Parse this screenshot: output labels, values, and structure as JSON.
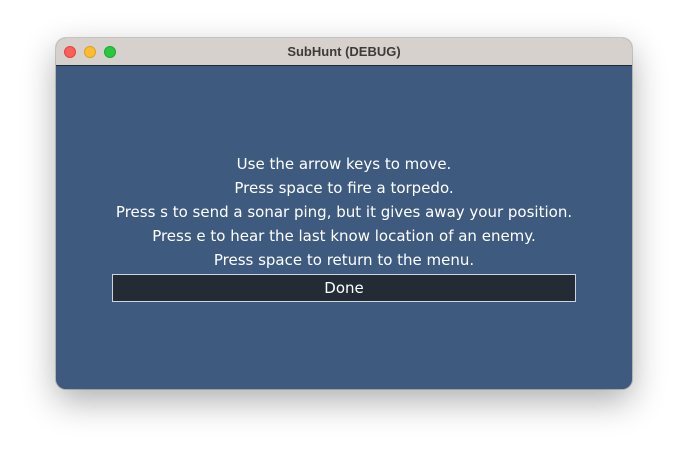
{
  "window": {
    "title": "SubHunt (DEBUG)"
  },
  "instructions": [
    "Use the arrow keys to move.",
    "Press space to fire a torpedo.",
    "Press s to send a sonar ping, but it gives away your position.",
    "Press e to hear the last know location of an enemy.",
    "Press space to return to the menu."
  ],
  "done_button": {
    "label": "Done"
  },
  "colors": {
    "background": "#3e5b7f",
    "button_background": "#232b37",
    "titlebar": "#d6d1cc",
    "text": "#ffffff"
  },
  "icons": {
    "close": "close-traffic-light-icon",
    "minimize": "minimize-traffic-light-icon",
    "zoom": "zoom-traffic-light-icon"
  }
}
